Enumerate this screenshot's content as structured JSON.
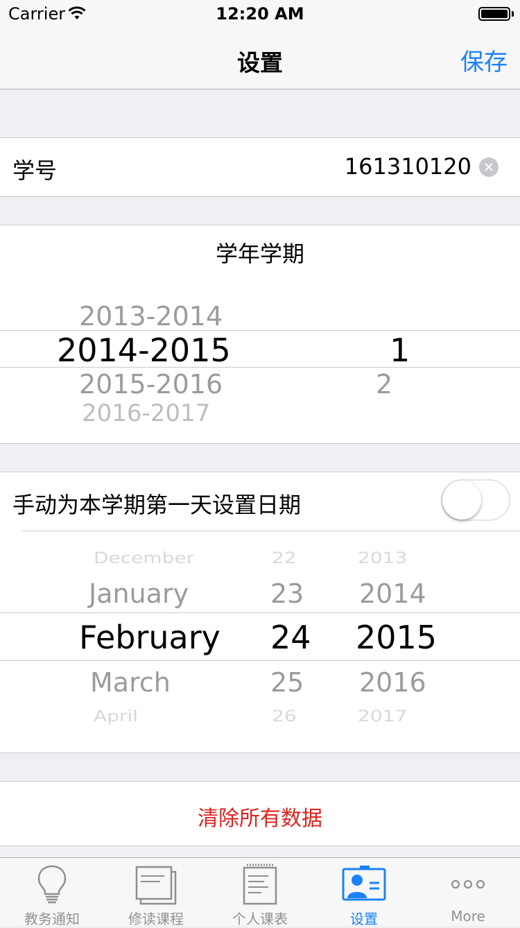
{
  "status_bar": {
    "carrier": "Carrier",
    "time": "12:20 AM"
  },
  "nav": {
    "title": "设置",
    "save_label": "保存"
  },
  "student_id": {
    "label": "学号",
    "value": "161310120"
  },
  "term": {
    "title": "学年学期",
    "years": [
      "2013-2014",
      "2014-2015",
      "2015-2016",
      "2016-2017"
    ],
    "terms": [
      "1",
      "2"
    ],
    "selected_year": "2014-2015",
    "selected_term": "1"
  },
  "first_day": {
    "label": "手动为本学期第一天设置日期",
    "toggle_on": false,
    "months": [
      "December",
      "January",
      "February",
      "March",
      "April"
    ],
    "days": [
      "22",
      "23",
      "24",
      "25",
      "26"
    ],
    "years": [
      "2013",
      "2014",
      "2015",
      "2016",
      "2017"
    ]
  },
  "clear_data_label": "清除所有数据",
  "tabs": [
    {
      "label": "教务通知",
      "icon": "lightbulb-icon"
    },
    {
      "label": "修读课程",
      "icon": "stacked-documents-icon"
    },
    {
      "label": "个人课表",
      "icon": "notepad-icon"
    },
    {
      "label": "设置",
      "icon": "id-card-icon",
      "active": true
    },
    {
      "label": "More",
      "icon": "more-dots-icon"
    }
  ],
  "colors": {
    "accent": "#1a82fb",
    "destructive": "#e0221c",
    "background": "#efeff4"
  }
}
